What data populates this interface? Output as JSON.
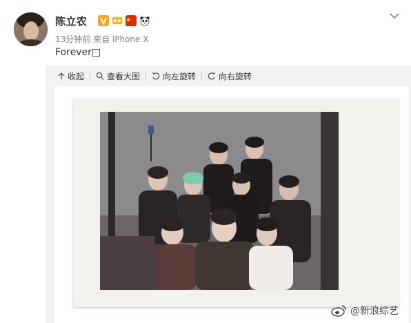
{
  "post": {
    "username": "陈立农",
    "meta": "13分钟前 来自 iPhone X",
    "content": "Forever□"
  },
  "toolbar": {
    "collapse_label": "收起",
    "view_large_label": "查看大图",
    "rotate_left_label": "向左旋转",
    "rotate_right_label": "向右旋转"
  },
  "watermark": {
    "text": "@新浪综艺"
  },
  "icons": [
    "avatar",
    "verified-badge",
    "vip-badge",
    "china-flag-icon",
    "panda-icon",
    "chevron-down-icon",
    "collapse-icon",
    "magnifier-icon",
    "rotate-left-icon",
    "rotate-right-icon",
    "weibo-logo-icon"
  ],
  "colors": {
    "badge_orange": "#f5a623",
    "flag_red": "#de2910",
    "panel_bg": "#f2f2f5"
  }
}
